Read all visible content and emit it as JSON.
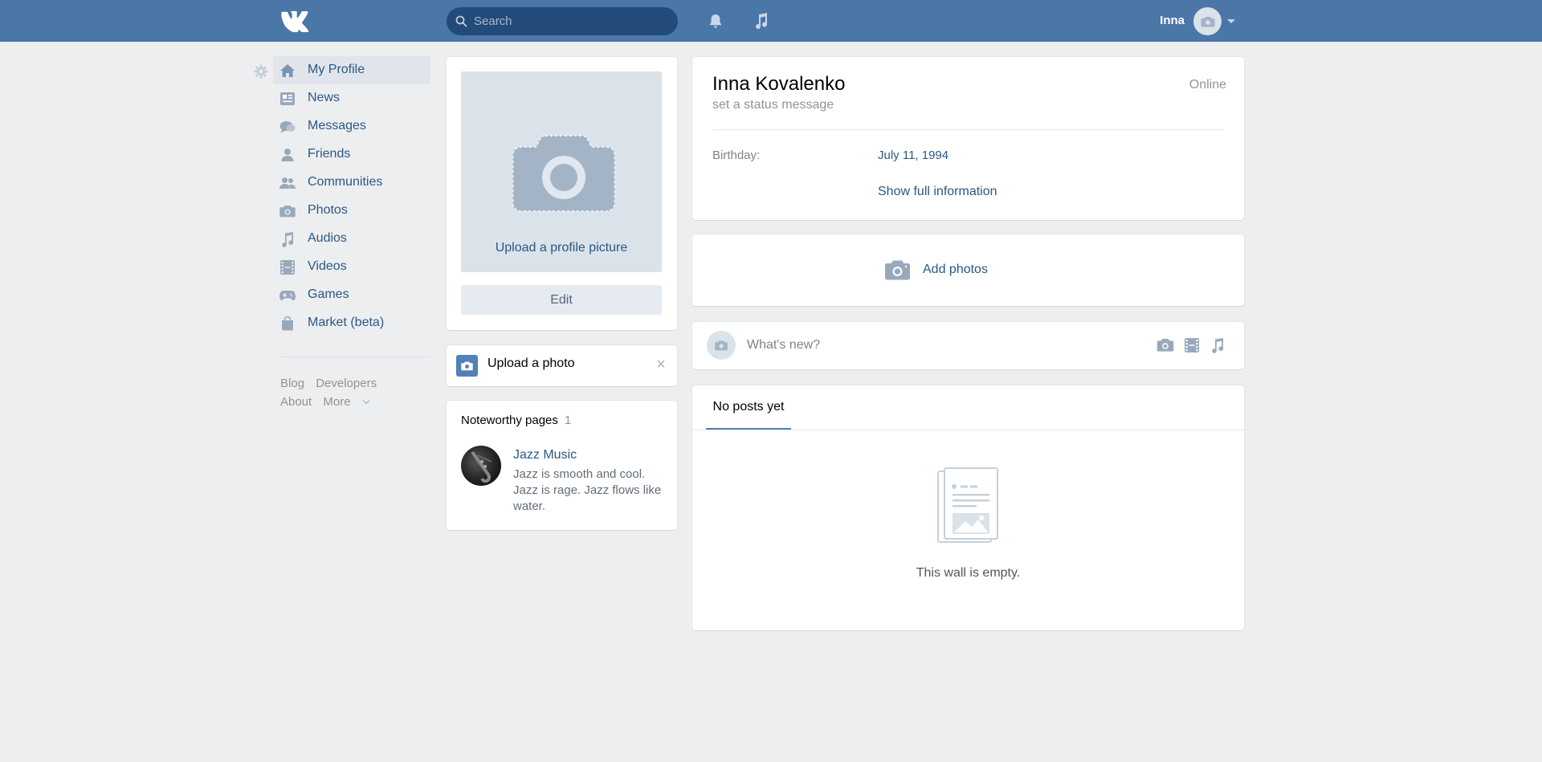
{
  "header": {
    "search_placeholder": "Search",
    "user_name": "Inna"
  },
  "nav": {
    "items": [
      {
        "label": "My Profile",
        "icon": "home-icon"
      },
      {
        "label": "News",
        "icon": "news-icon"
      },
      {
        "label": "Messages",
        "icon": "messages-icon"
      },
      {
        "label": "Friends",
        "icon": "friend-icon"
      },
      {
        "label": "Communities",
        "icon": "communities-icon"
      },
      {
        "label": "Photos",
        "icon": "camera-icon"
      },
      {
        "label": "Audios",
        "icon": "music-note-icon"
      },
      {
        "label": "Videos",
        "icon": "film-icon"
      },
      {
        "label": "Games",
        "icon": "gamepad-icon"
      },
      {
        "label": "Market (beta)",
        "icon": "bag-icon"
      }
    ],
    "active_index": 0,
    "footer": {
      "blog": "Blog",
      "developers": "Developers",
      "about": "About",
      "more": "More"
    }
  },
  "avatar_card": {
    "upload_label": "Upload a profile picture",
    "edit_label": "Edit"
  },
  "upload_card": {
    "text": "Upload a photo"
  },
  "noteworthy": {
    "title": "Noteworthy pages",
    "count": "1",
    "page_name": "Jazz Music",
    "page_desc": "Jazz is smooth and cool. Jazz is rage. Jazz flows like water."
  },
  "profile": {
    "name": "Inna Kovalenko",
    "online": "Online",
    "status_placeholder": "set a status message",
    "birthday_label": "Birthday:",
    "birthday_value": "July 11, 1994",
    "show_full": "Show full information"
  },
  "photos_card": {
    "add_photos": "Add photos"
  },
  "post_box": {
    "placeholder": "What's new?"
  },
  "wall": {
    "tab_label": "No posts yet",
    "empty_text": "This wall is empty."
  },
  "colors": {
    "header_bg": "#4a76a8",
    "link": "#2a5885",
    "page_bg": "#edeef0",
    "icon_gray": "#99a9bc"
  }
}
